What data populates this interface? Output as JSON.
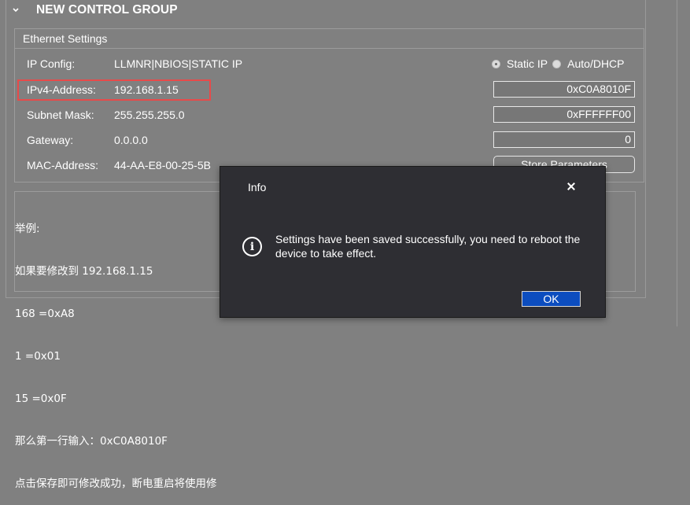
{
  "group": {
    "title": "NEW CONTROL GROUP"
  },
  "ethernet": {
    "title": "Ethernet Settings",
    "ip_config": {
      "label": "IP Config:",
      "value": "LLMNR|NBIOS|STATIC IP"
    },
    "ipv4": {
      "label": "IPv4-Address:",
      "value": "192.168.1.15",
      "hex": "0xC0A8010F"
    },
    "subnet": {
      "label": "Subnet Mask:",
      "value": "255.255.255.0",
      "hex": "0xFFFFFF00"
    },
    "gateway": {
      "label": "Gateway:",
      "value": "0.0.0.0",
      "hex": "0"
    },
    "mac": {
      "label": "MAC-Address:",
      "value": "44-AA-E8-00-25-5B"
    },
    "mode_static": "Static IP",
    "mode_dhcp": "Auto/DHCP",
    "selected_mode": "Static IP",
    "store_label": "Store Parameters"
  },
  "example": {
    "lines": [
      "举例:",
      "如果要修改到 192.168.1.15",
      "168 =0xA8",
      "1 =0x01",
      "15 =0x0F",
      "那么第一行输入：0xC0A8010F",
      "点击保存即可修改成功，断电重启将使用修"
    ]
  },
  "dialog": {
    "title": "Info",
    "message": "Settings have been saved successfully, you need to reboot the device to take effect.",
    "ok_label": "OK",
    "icon": "info-icon"
  },
  "colors": {
    "background": "#808080",
    "dialog_bg": "#2e2e33",
    "ok_button": "#0c4dbf",
    "highlight": "#e84a4a"
  }
}
